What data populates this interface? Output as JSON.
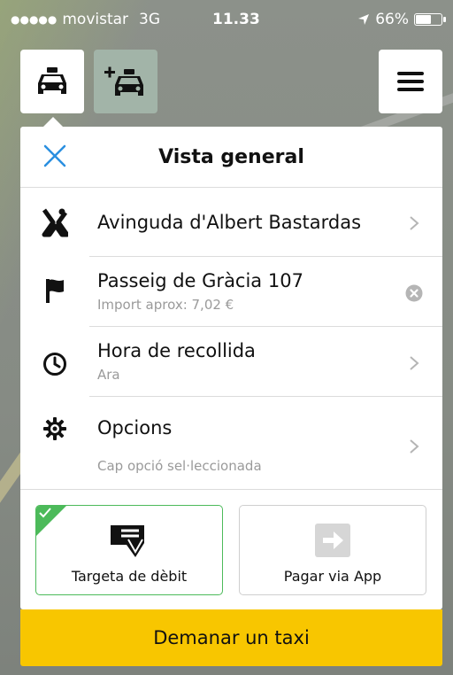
{
  "status_bar": {
    "signal": "●●●●●",
    "carrier": "movistar",
    "network": "3G",
    "time": "11.33",
    "battery": "66%",
    "battery_level": 0.66
  },
  "top_buttons": {
    "taxi_icon": "taxi-icon",
    "add_taxi_icon": "add-taxi-icon",
    "menu_icon": "hamburger-menu-icon"
  },
  "panel": {
    "title": "Vista general",
    "close_icon": "close-icon",
    "rows": [
      {
        "icon": "pickup-marker-icon",
        "label": "Avinguda d'Albert Bastardas",
        "sub": "",
        "action": "chevron-right-icon"
      },
      {
        "icon": "flag-icon",
        "label": "Passeig de Gràcia 107",
        "sub": "Import aprox: 7,02 €",
        "action": "clear-icon"
      },
      {
        "icon": "clock-icon",
        "label": "Hora de recollida",
        "sub": "Ara",
        "action": "chevron-right-icon"
      },
      {
        "icon": "gear-icon",
        "label": "Opcions",
        "sub": "Cap opció sel·leccionada",
        "action": "chevron-right-icon"
      }
    ]
  },
  "payment": {
    "options": [
      {
        "label": "Targeta de dèbit",
        "icon": "card-icon",
        "selected": true
      },
      {
        "label": "Pagar via App",
        "icon": "app-pay-icon",
        "selected": false
      }
    ]
  },
  "cta": {
    "label": "Demanar un taxi"
  },
  "colors": {
    "accent_green": "#4cba5a",
    "cta_yellow": "#f8c600",
    "close_blue": "#2a8fe0"
  }
}
